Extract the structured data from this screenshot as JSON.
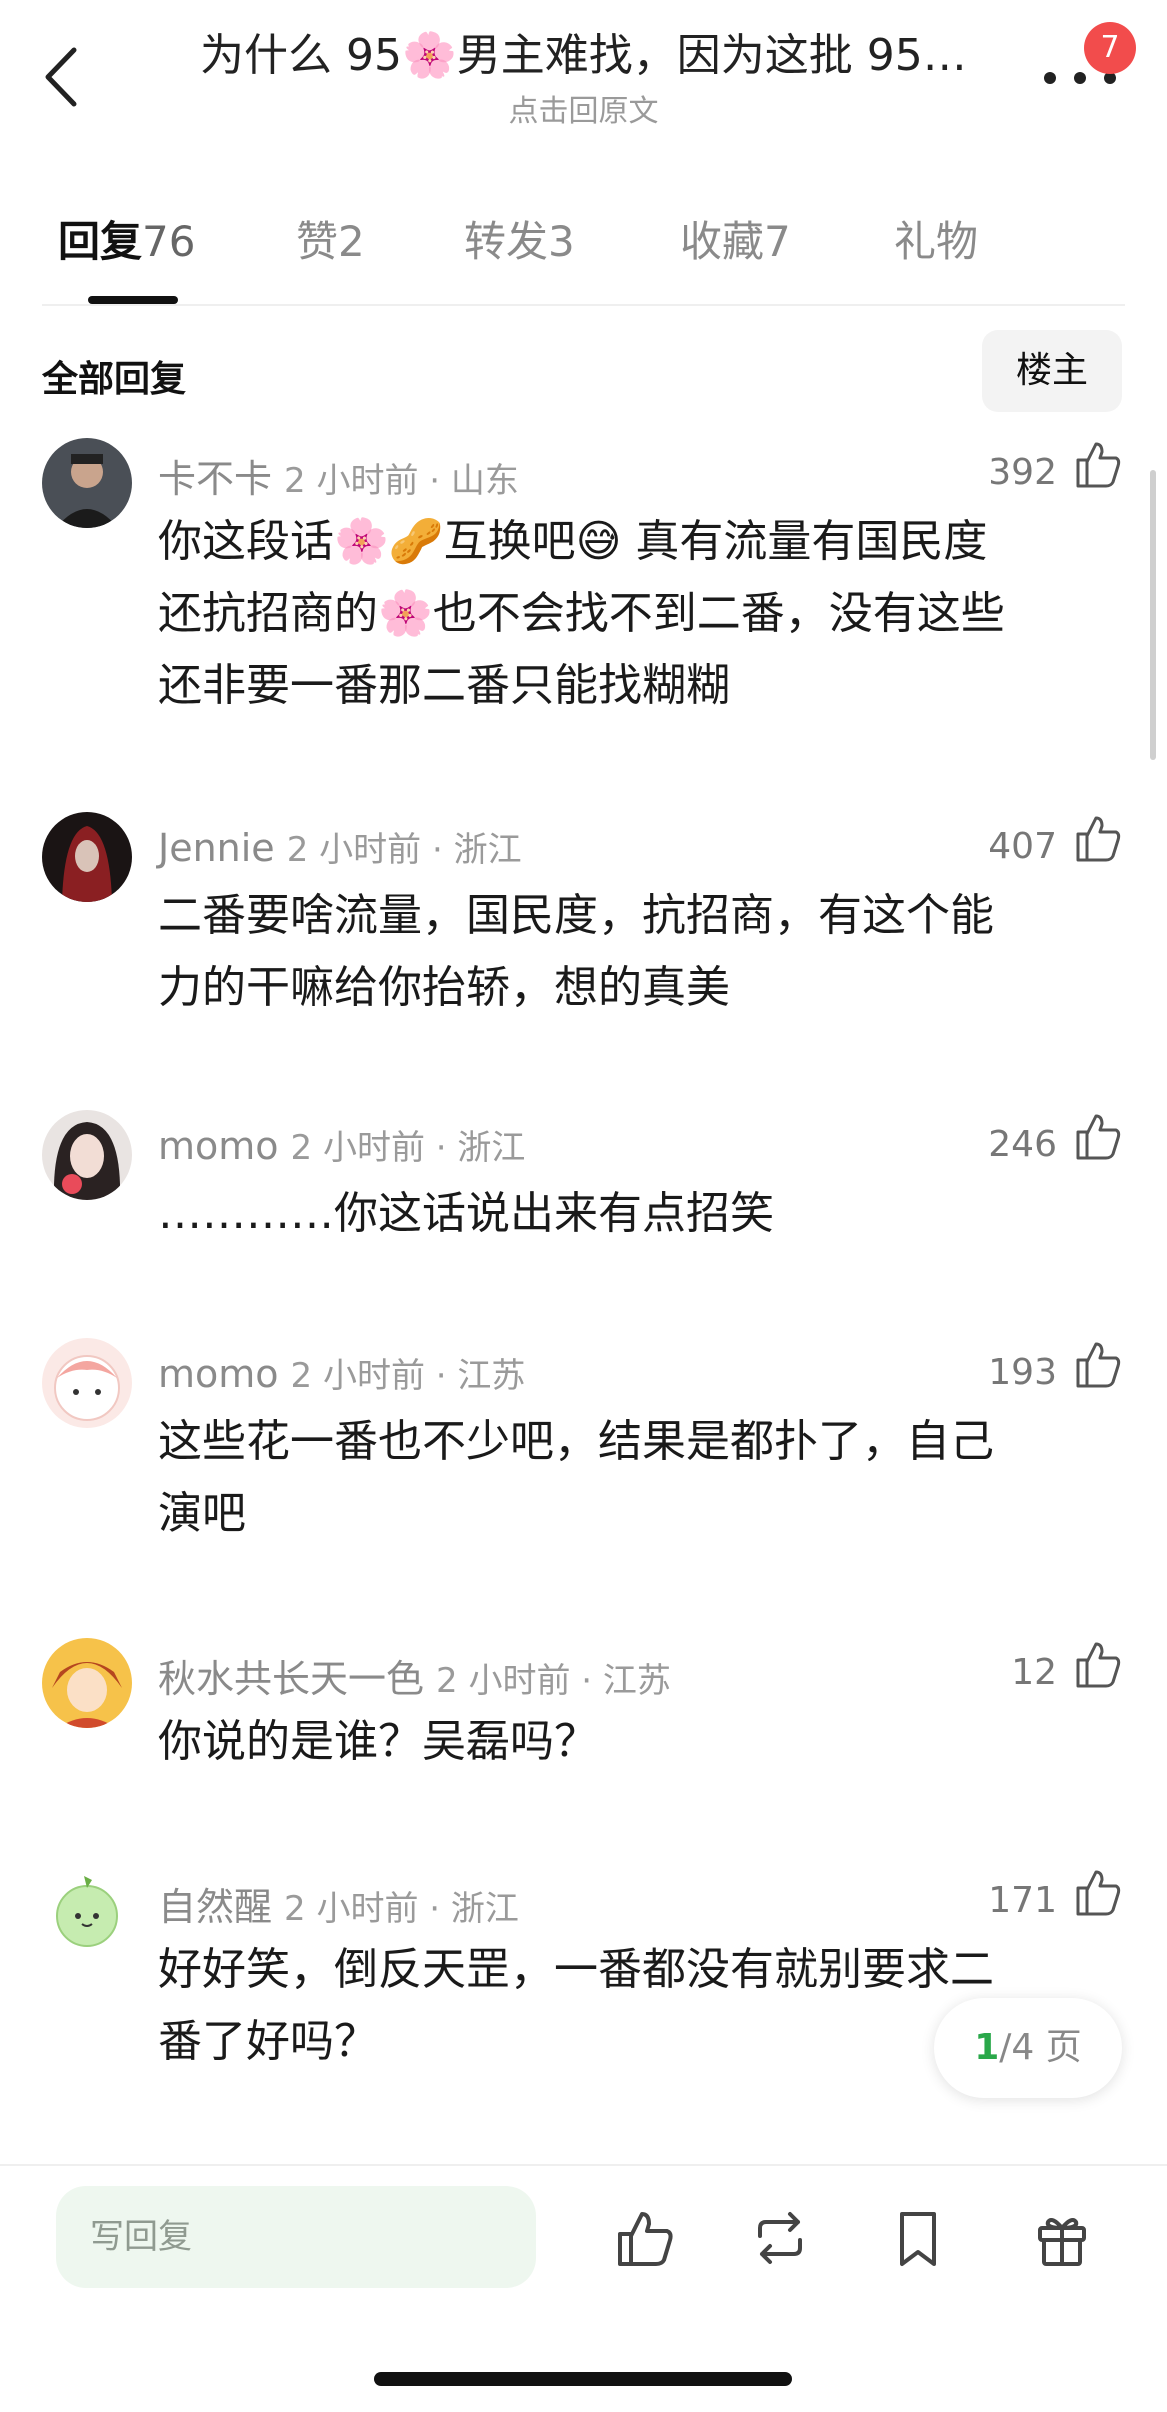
{
  "header": {
    "title": "为什么 95🌸男主难找，因为这批 95…",
    "subtitle": "点击回原文",
    "badge_count": "7"
  },
  "tabs": [
    {
      "label": "回复",
      "count": "76",
      "active": true
    },
    {
      "label": "赞",
      "count": "2"
    },
    {
      "label": "转发",
      "count": "3"
    },
    {
      "label": "收藏",
      "count": "7"
    },
    {
      "label": "礼物",
      "count": ""
    }
  ],
  "section": {
    "title": "全部回复",
    "filter_label": "楼主"
  },
  "comments": [
    {
      "name": "卡不卡",
      "meta": "2 小时前 · 山东",
      "likes": "392",
      "lines": [
        "你这段话🌸🥜互换吧😅 真有流量有国民度",
        "还抗招商的🌸也不会找不到二番，没有这些",
        "还非要一番那二番只能找糊糊"
      ]
    },
    {
      "name": "Jennie",
      "meta": "2 小时前 · 浙江",
      "likes": "407",
      "lines": [
        "二番要啥流量，国民度，抗招商，有这个能",
        "力的干嘛给你抬轿，想的真美"
      ]
    },
    {
      "name": "momo",
      "meta": "2 小时前 · 浙江",
      "likes": "246",
      "lines": [
        "…………你这话说出来有点招笑"
      ]
    },
    {
      "name": "momo",
      "meta": "2 小时前 · 江苏",
      "likes": "193",
      "lines": [
        "这些花一番也不少吧，结果是都扑了，自己",
        "演吧"
      ]
    },
    {
      "name": "秋水共长天一色",
      "meta": "2 小时前 · 江苏",
      "likes": "12",
      "lines": [
        "你说的是谁？吴磊吗？"
      ]
    },
    {
      "name": "自然醒",
      "meta": "2 小时前 · 浙江",
      "likes": "171",
      "lines": [
        "好好笑，倒反天罡，一番都没有就别要求二",
        "番了好吗？"
      ]
    }
  ],
  "pager": {
    "current": "1",
    "total": "/4 页"
  },
  "bottom_bar": {
    "reply_placeholder": "写回复"
  },
  "colors": {
    "accent_green": "#2aa84a",
    "badge_red": "#f24c4c",
    "input_bg": "#eef7ef"
  }
}
